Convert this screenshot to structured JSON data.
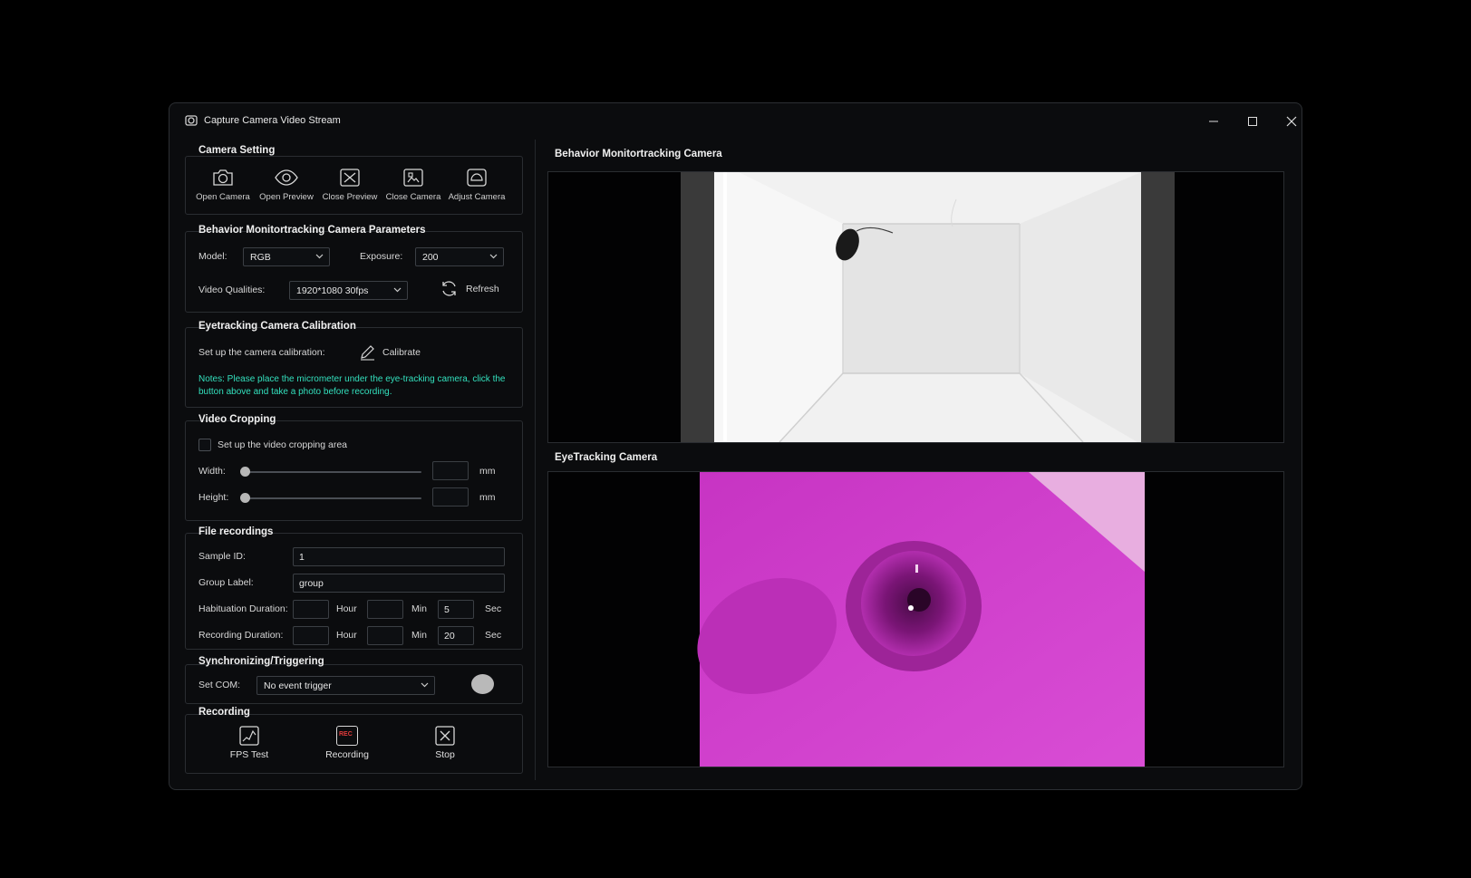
{
  "window": {
    "title": "Capture Camera Video Stream"
  },
  "camera_setting": {
    "title": "Camera Setting",
    "buttons": [
      {
        "label": "Open Camera",
        "icon": "camera-icon"
      },
      {
        "label": "Open Preview",
        "icon": "eye-icon"
      },
      {
        "label": "Close Preview",
        "icon": "close-preview-icon"
      },
      {
        "label": "Close Camera",
        "icon": "close-camera-icon"
      },
      {
        "label": "Adjust Camera",
        "icon": "adjust-camera-icon"
      }
    ]
  },
  "behavior_params": {
    "title": "Behavior Monitortracking Camera Parameters",
    "model_label": "Model:",
    "model_value": "RGB",
    "exposure_label": "Exposure:",
    "exposure_value": "200",
    "quality_label": "Video Qualities:",
    "quality_value": "1920*1080 30fps",
    "refresh_label": "Refresh"
  },
  "eyetracking_calibration": {
    "title": "Eyetracking Camera Calibration",
    "setup_label": "Set up the camera calibration:",
    "calibrate_label": "Calibrate",
    "note": "Notes: Please place the micrometer under the eye-tracking camera, click the button above and take a photo before recording."
  },
  "video_cropping": {
    "title": "Video Cropping",
    "checkbox_label": "Set up the video cropping area",
    "width_label": "Width:",
    "height_label": "Height:",
    "unit": "mm",
    "width_value": "",
    "height_value": ""
  },
  "file_recordings": {
    "title": "File recordings",
    "sample_id_label": "Sample ID:",
    "sample_id_value": "1",
    "group_label_label": "Group Label:",
    "group_label_value": "group",
    "habituation_label": "Habituation Duration:",
    "recording_label": "Recording Duration:",
    "hour_unit": "Hour",
    "min_unit": "Min",
    "sec_unit": "Sec",
    "habituation": {
      "hour": "",
      "min": "",
      "sec": "5"
    },
    "recording": {
      "hour": "",
      "min": "",
      "sec": "20"
    }
  },
  "sync": {
    "title": "Synchronizing/Triggering",
    "com_label": "Set COM:",
    "com_value": "No event trigger"
  },
  "recording": {
    "title": "Recording",
    "fps_label": "FPS Test",
    "rec_label": "Recording",
    "rec_icon_text": "REC",
    "stop_label": "Stop"
  },
  "cameras": {
    "behavior_title": "Behavior Monitortracking Camera",
    "eye_title": "EyeTracking Camera"
  },
  "colors": {
    "accent_note": "#33e0bd",
    "eye_tint": "#d43ad0"
  }
}
